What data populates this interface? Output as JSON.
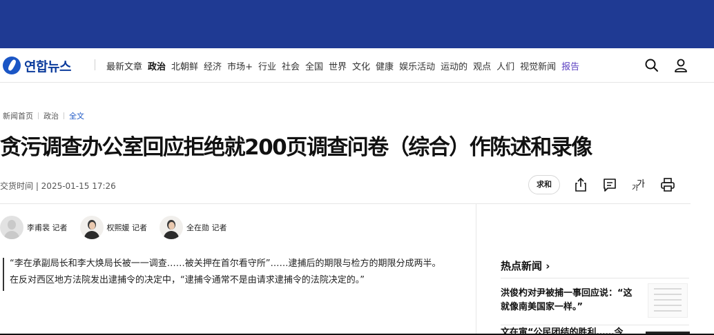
{
  "header": {
    "logo_text": "연합뉴스",
    "menu": [
      "最新文章",
      "政治",
      "北朝鲜",
      "经济",
      "市场+",
      "行业",
      "社会",
      "全国",
      "世界",
      "文化",
      "健康",
      "娱乐活动",
      "运动的",
      "观点",
      "人们",
      "视觉新闻",
      "报告"
    ],
    "search_icon": "search-icon",
    "user_icon": "user-icon"
  },
  "breadcrumb": {
    "home": "新闻首页",
    "section": "政治",
    "current": "全文"
  },
  "article": {
    "headline": "贪污调查办公室回应拒绝就200页调查问卷（综合）作陈述和录像",
    "meta": "交货时间 | 2025-01-15 17:26",
    "sum_button": "求和",
    "reporters": [
      {
        "name": "李甫裴 记者"
      },
      {
        "name": "权熙媛 记者"
      },
      {
        "name": "全在勋 记者"
      }
    ],
    "summary": [
      "“李在承副局长和李大焕局长被一一调查……被关押在首尔看守所”……逮捕后的期限与检方的期限分成两半。",
      "在反对西区地方法院发出逮捕令的决定中，“逮捕令通常不是由请求逮捕令的法院决定的。”"
    ]
  },
  "sidebar": {
    "title": "热点新闻",
    "title_arrow": "›",
    "items": [
      {
        "text": "洪俊杓对尹被捕一事回应说：“这就像南美国家一样。”"
      },
      {
        "text": "文在寅“公民团结的胜利……今"
      }
    ]
  },
  "colors": {
    "top_band": "#1f3a93",
    "accent": "#1b56c5",
    "report": "#5a3fc0"
  }
}
